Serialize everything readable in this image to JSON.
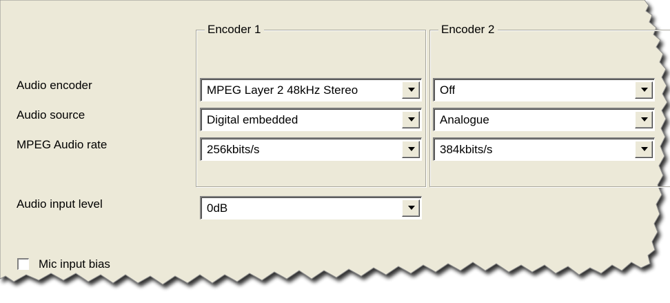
{
  "groups": {
    "encoder1": {
      "title": "Encoder 1"
    },
    "encoder2": {
      "title": "Encoder 2"
    }
  },
  "labels": {
    "audio_encoder": "Audio encoder",
    "audio_source": "Audio source",
    "mpeg_audio_rate": "MPEG Audio rate",
    "audio_input_level": "Audio input level"
  },
  "encoder1": {
    "audio_encoder": "MPEG Layer 2 48kHz Stereo",
    "audio_source": "Digital embedded",
    "mpeg_audio_rate": "256kbits/s"
  },
  "encoder2": {
    "audio_encoder": "Off",
    "audio_source": "Analogue",
    "mpeg_audio_rate": "384kbits/s"
  },
  "audio_input_level": {
    "value": "0dB"
  },
  "mic_input_bias": {
    "label": "Mic input bias",
    "checked": false
  },
  "icons": {
    "dropdown": "chevron-down-icon"
  },
  "colors": {
    "panel_bg": "#ece9d8",
    "field_bg": "#ffffff",
    "group_border": "#a7a69d",
    "torn_shadow": "#4a4a4a"
  }
}
